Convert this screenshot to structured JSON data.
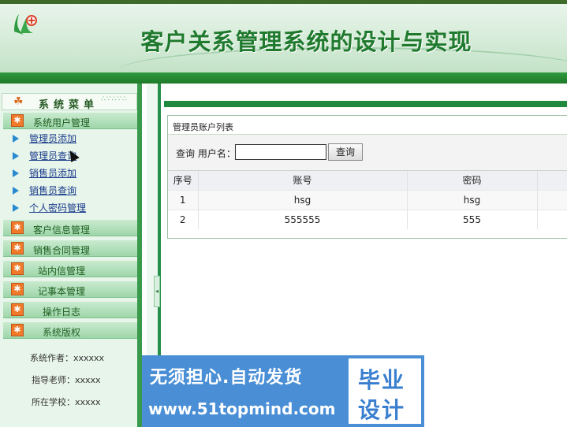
{
  "header": {
    "title": "客户关系管理系统的设计与实现",
    "logo_icon": "leaf-logo-icon"
  },
  "sidebar": {
    "menu_title": "系统菜单",
    "groups": [
      {
        "label": "系统用户管理",
        "items": [
          "管理员添加",
          "管理员查询",
          "销售员添加",
          "销售员查询",
          "个人密码管理"
        ]
      },
      {
        "label": "客户信息管理"
      },
      {
        "label": "销售合同管理"
      },
      {
        "label": "站内信管理"
      },
      {
        "label": "记事本管理"
      },
      {
        "label": "操作日志"
      },
      {
        "label": "系统版权"
      }
    ],
    "author": "系统作者：xxxxxx",
    "teacher": "指导老师：xxxxx",
    "school": "所在学校：xxxxx"
  },
  "main": {
    "panel_title": "管理员账户列表",
    "search_label": "查询 用户名：",
    "search_value": "",
    "search_button": "查询",
    "columns": [
      "序号",
      "账号",
      "密码"
    ],
    "rows": [
      [
        "1",
        "hsg",
        "hsg"
      ],
      [
        "2",
        "555555",
        "555"
      ]
    ]
  },
  "watermark": {
    "line1": "无须担心.自动发货",
    "line2": "www.51topmind.com",
    "box_top": "毕业",
    "box_bottom": "设计"
  },
  "colors": {
    "brand_green": "#1f7a2e",
    "accent_orange": "#f07a2a",
    "link_blue": "#1a3c8c"
  }
}
